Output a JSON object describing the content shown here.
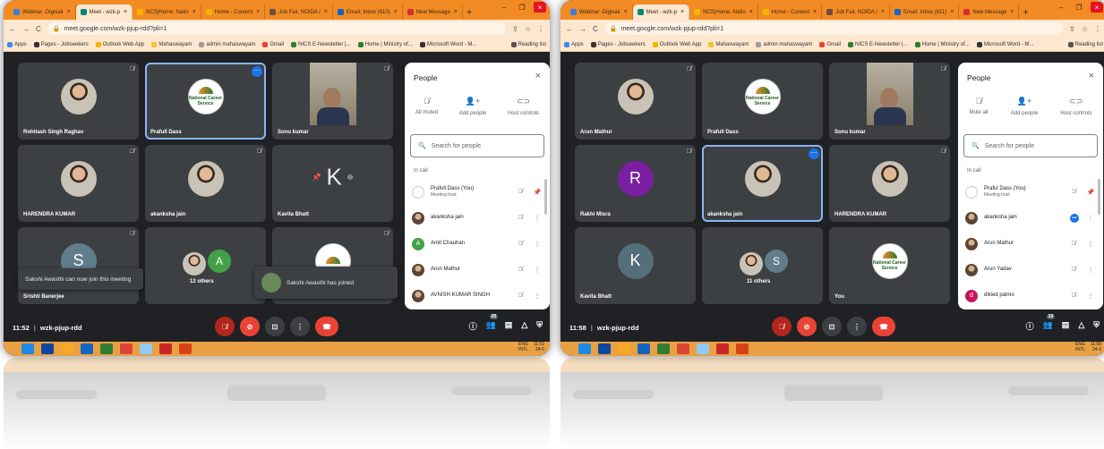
{
  "left": {
    "tabs": [
      "Webinar -Digisak",
      "Meet - wzk-p",
      "NCS|Home: Natio",
      "Home - Content",
      "Job Fair, NOIDA /",
      "Email: Inbox (610)",
      "New Message"
    ],
    "url": "meet.google.com/wzk-pjup-rdd?pli=1",
    "tiles": [
      {
        "name": "Rohitash Singh Raghav"
      },
      {
        "name": "Prafull Dass"
      },
      {
        "name": "Sonu kumar"
      },
      {
        "name": "HARENDRA KUMAR"
      },
      {
        "name": "akanksha jain"
      },
      {
        "name": "Kavita Bhatt",
        "initial": "K"
      },
      {
        "name": "Srishti Banerjee",
        "initial": "S"
      },
      {
        "name": "12 others",
        "initial": "A"
      },
      {
        "name": ""
      }
    ],
    "toast_left": "Sakshi Awasthi can now join this meeting",
    "toast_right": "Sakshi Awasthi has joined",
    "people": {
      "title": "People",
      "actions": [
        "All muted",
        "Add people",
        "Host controls"
      ],
      "search_placeholder": "Search for people",
      "in_call": "In call",
      "list": [
        {
          "name": "Prafull Dass (You)",
          "sub": "Meeting host"
        },
        {
          "name": "akanksha jain"
        },
        {
          "name": "Amit Chauhan",
          "initial": "A"
        },
        {
          "name": "Arun Mathur"
        },
        {
          "name": "AVNISH KUMAR SINGH"
        }
      ]
    },
    "time": "11:52",
    "meeting_code": "wzk-pjup-rdd",
    "participant_count": "20",
    "tray_lang": "ENG\nINTL",
    "tray_time": "11:52\n24-0"
  },
  "right": {
    "tabs": [
      "Webinar -Digisak",
      "Meet - wzk-p",
      "NCS|Home: Natio",
      "Home - Content",
      "Job Fair, NOIDA /",
      "Email: Inbox (611)",
      "New Message"
    ],
    "url": "meet.google.com/wzk-pjup-rdd?pli=1",
    "tiles": [
      {
        "name": "Arun Mathur"
      },
      {
        "name": "Prafull Dass"
      },
      {
        "name": "Sonu kumar"
      },
      {
        "name": "Rakhi Misra",
        "initial": "R"
      },
      {
        "name": "akanksha jain"
      },
      {
        "name": "HARENDRA KUMAR"
      },
      {
        "name": "Kavita Bhatt",
        "initial": "K"
      },
      {
        "name": "11 others",
        "initial": "S"
      },
      {
        "name": "You"
      }
    ],
    "people": {
      "title": "People",
      "actions": [
        "Mute all",
        "Add people",
        "Host controls"
      ],
      "search_placeholder": "Search for people",
      "in_call": "In call",
      "list": [
        {
          "name": "Praful Dass (You)",
          "sub": "Meeting host"
        },
        {
          "name": "akanksha jain"
        },
        {
          "name": "Arun Mathur"
        },
        {
          "name": "Arun Yadav"
        },
        {
          "name": "dikied palmo",
          "initial": "d"
        }
      ]
    },
    "time": "11:58",
    "meeting_code": "wzk-pjup-rdd",
    "participant_count": "19",
    "tray_lang": "ENG\nINTL",
    "tray_time": "11:58\n24-0"
  },
  "bookmarks": [
    "Apps",
    "Pages - Jobseekers",
    "Outlook Web App",
    "Mahaswayam",
    "admin mahaswayam",
    "Gmail",
    "NICS E-Newsletter |...",
    "Home | Ministry of...",
    "Microsoft Word - M..."
  ],
  "reading_list": "Reading list",
  "logo_text": "National Career Service",
  "colors": {
    "meet_bg": "#202124",
    "tile_bg": "#3c4043",
    "browser_frame": "#f28b24",
    "end_call": "#ea4335",
    "accent": "#1a73e8"
  }
}
